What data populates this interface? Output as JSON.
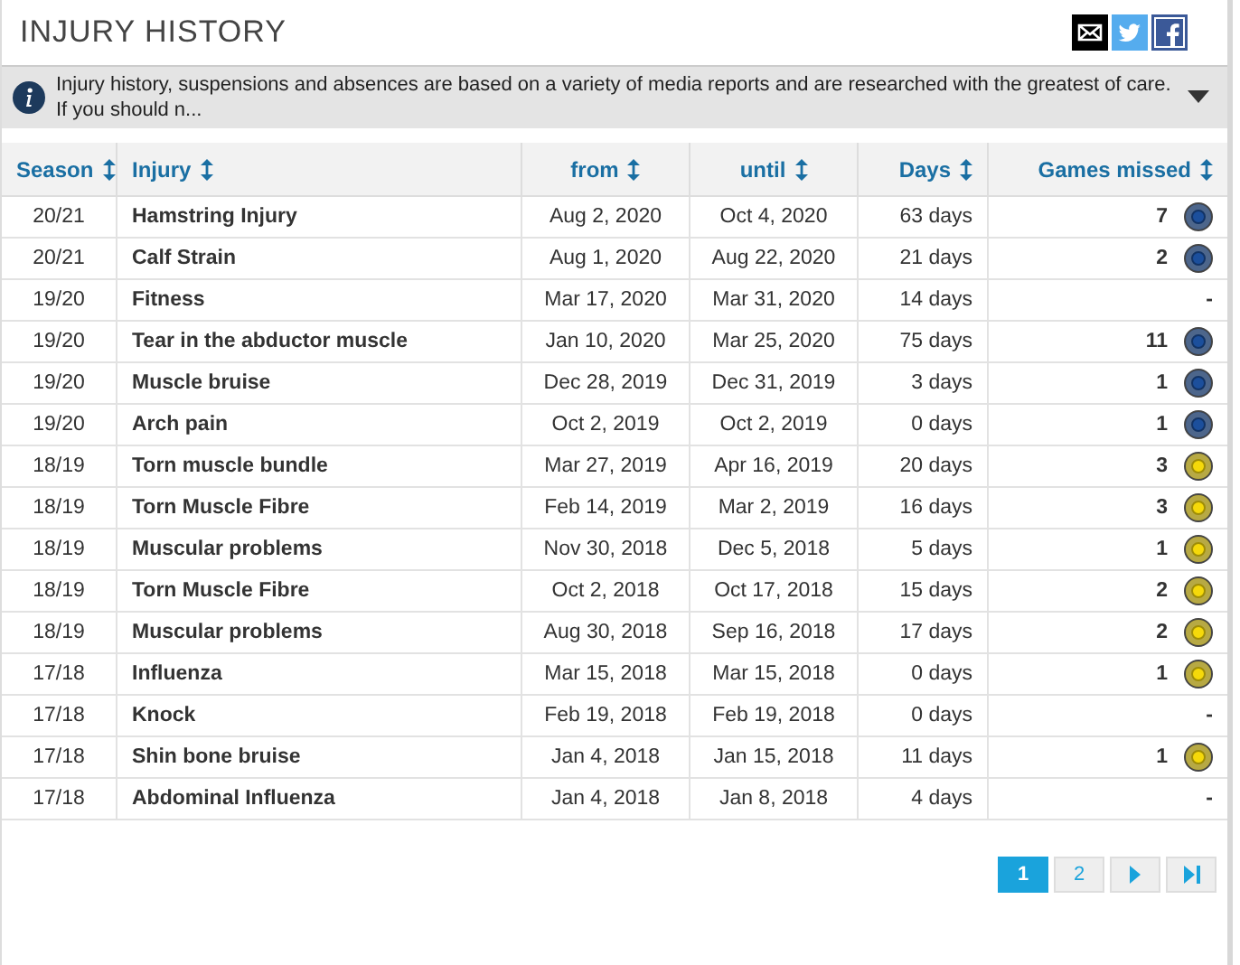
{
  "title": "INJURY HISTORY",
  "share": [
    {
      "kind": "email"
    },
    {
      "kind": "twitter"
    },
    {
      "kind": "facebook"
    }
  ],
  "notice": {
    "text": "Injury history, suspensions and absences are based on a variety of media reports and are researched with the greatest of care. If you should n...",
    "expanded": false
  },
  "table": {
    "columns": [
      {
        "label": "Season"
      },
      {
        "label": "Injury"
      },
      {
        "label": "from"
      },
      {
        "label": "until"
      },
      {
        "label": "Days"
      },
      {
        "label": "Games missed"
      }
    ],
    "rows": [
      {
        "season": "20/21",
        "injury": "Hamstring Injury",
        "from": "Aug 2, 2020",
        "until": "Oct 4, 2020",
        "days": "63 days",
        "games": "7",
        "color": "#1c4f9c"
      },
      {
        "season": "20/21",
        "injury": "Calf Strain",
        "from": "Aug 1, 2020",
        "until": "Aug 22, 2020",
        "days": "21 days",
        "games": "2",
        "color": "#1c4f9c"
      },
      {
        "season": "19/20",
        "injury": "Fitness",
        "from": "Mar 17, 2020",
        "until": "Mar 31, 2020",
        "days": "14 days",
        "games": "-"
      },
      {
        "season": "19/20",
        "injury": "Tear in the abductor muscle",
        "from": "Jan 10, 2020",
        "until": "Mar 25, 2020",
        "days": "75 days",
        "games": "11",
        "color": "#1c4f9c"
      },
      {
        "season": "19/20",
        "injury": "Muscle bruise",
        "from": "Dec 28, 2019",
        "until": "Dec 31, 2019",
        "days": "3 days",
        "games": "1",
        "color": "#1c4f9c"
      },
      {
        "season": "19/20",
        "injury": "Arch pain",
        "from": "Oct 2, 2019",
        "until": "Oct 2, 2019",
        "days": "0 days",
        "games": "1",
        "color": "#1c4f9c"
      },
      {
        "season": "18/19",
        "injury": "Torn muscle bundle",
        "from": "Mar 27, 2019",
        "until": "Apr 16, 2019",
        "days": "20 days",
        "games": "3",
        "color": "#f5d90a"
      },
      {
        "season": "18/19",
        "injury": "Torn Muscle Fibre",
        "from": "Feb 14, 2019",
        "until": "Mar 2, 2019",
        "days": "16 days",
        "games": "3",
        "color": "#f5d90a"
      },
      {
        "season": "18/19",
        "injury": "Muscular problems",
        "from": "Nov 30, 2018",
        "until": "Dec 5, 2018",
        "days": "5 days",
        "games": "1",
        "color": "#f5d90a"
      },
      {
        "season": "18/19",
        "injury": "Torn Muscle Fibre",
        "from": "Oct 2, 2018",
        "until": "Oct 17, 2018",
        "days": "15 days",
        "games": "2",
        "color": "#f5d90a"
      },
      {
        "season": "18/19",
        "injury": "Muscular problems",
        "from": "Aug 30, 2018",
        "until": "Sep 16, 2018",
        "days": "17 days",
        "games": "2",
        "color": "#f5d90a"
      },
      {
        "season": "17/18",
        "injury": "Influenza",
        "from": "Mar 15, 2018",
        "until": "Mar 15, 2018",
        "days": "0 days",
        "games": "1",
        "color": "#f5d90a"
      },
      {
        "season": "17/18",
        "injury": "Knock",
        "from": "Feb 19, 2018",
        "until": "Feb 19, 2018",
        "days": "0 days",
        "games": "-"
      },
      {
        "season": "17/18",
        "injury": "Shin bone bruise",
        "from": "Jan 4, 2018",
        "until": "Jan 15, 2018",
        "days": "11 days",
        "games": "1",
        "color": "#f5d90a"
      },
      {
        "season": "17/18",
        "injury": "Abdominal Influenza",
        "from": "Jan 4, 2018",
        "until": "Jan 8, 2018",
        "days": "4 days",
        "games": "-"
      }
    ]
  },
  "pagination": [
    {
      "kind": "page",
      "label": "1",
      "selected": true
    },
    {
      "kind": "page",
      "label": "2",
      "selected": false
    },
    {
      "kind": "next"
    },
    {
      "kind": "last"
    }
  ]
}
